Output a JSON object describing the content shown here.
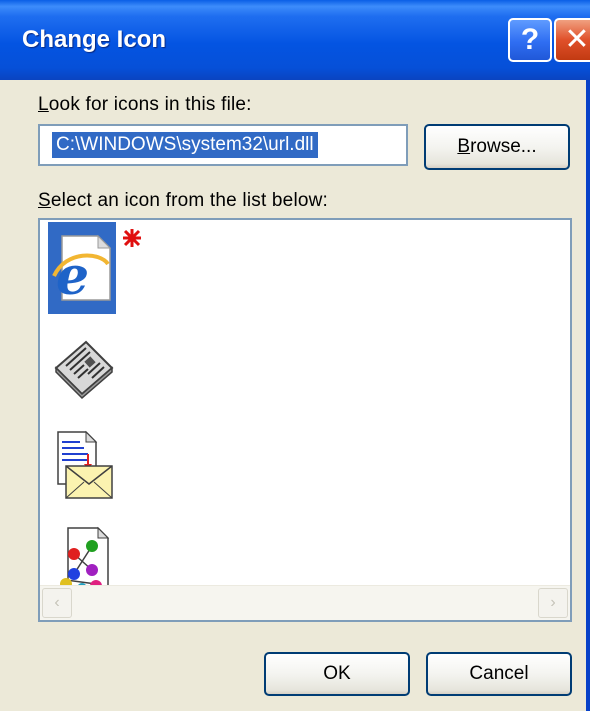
{
  "window": {
    "title": "Change Icon",
    "help_glyph": "?",
    "close_glyph": "✕"
  },
  "file_section": {
    "label_mnemonic": "L",
    "label_rest": "ook for icons in this file:",
    "path_value": "C:\\WINDOWS\\system32\\url.dll",
    "browse_mnemonic": "B",
    "browse_rest": "rowse..."
  },
  "list_section": {
    "label_mnemonic": "S",
    "label_rest": "elect an icon from the list below:",
    "icons": [
      {
        "name": "internet-explorer-icon",
        "selected": true
      },
      {
        "name": "newspaper-icon",
        "selected": false
      },
      {
        "name": "mail-document-icon",
        "selected": false
      },
      {
        "name": "molecule-document-icon",
        "selected": false
      }
    ],
    "scroll_left_glyph": "‹",
    "scroll_right_glyph": "›"
  },
  "buttons": {
    "ok_label": "OK",
    "cancel_label": "Cancel"
  },
  "colors": {
    "titlebar": "#0454e2",
    "dialog_bg": "#ece9d8",
    "selection": "#316ac5",
    "button_border": "#003c74"
  }
}
